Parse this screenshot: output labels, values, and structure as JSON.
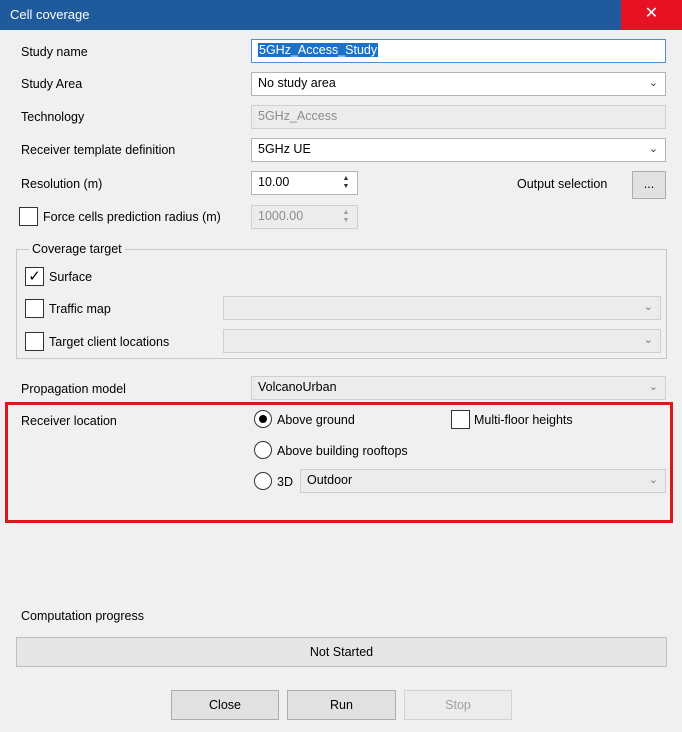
{
  "window": {
    "title": "Cell coverage",
    "close_glyph": "✕"
  },
  "fields": {
    "study_name": {
      "label": "Study name",
      "value": "5GHz_Access_Study"
    },
    "study_area": {
      "label": "Study Area",
      "value": "No study area"
    },
    "technology": {
      "label": "Technology",
      "value": "5GHz_Access"
    },
    "receiver_template": {
      "label": "Receiver template definition",
      "value": "5GHz UE"
    },
    "resolution": {
      "label": "Resolution (m)",
      "value": "10.00"
    },
    "output_selection": {
      "label": "Output selection",
      "button_label": "..."
    },
    "force_radius": {
      "label": "Force cells prediction radius (m)",
      "value": "1000.00",
      "checked": false
    }
  },
  "coverage_target": {
    "title": "Coverage target",
    "surface": {
      "label": "Surface",
      "checked": true,
      "check_glyph": "✓"
    },
    "traffic_map": {
      "label": "Traffic map",
      "checked": false,
      "value": ""
    },
    "target_client_locations": {
      "label": "Target client locations",
      "checked": false,
      "value": ""
    }
  },
  "propagation_model": {
    "label": "Propagation model",
    "value": "VolcanoUrban"
  },
  "receiver_location": {
    "label": "Receiver location",
    "above_ground": {
      "label": "Above ground",
      "selected": true
    },
    "multi_floor": {
      "label": "Multi-floor heights",
      "checked": false
    },
    "above_rooftops": {
      "label": "Above building rooftops",
      "selected": false
    },
    "three_d": {
      "label": "3D",
      "selected": false,
      "value": "Outdoor"
    }
  },
  "progress": {
    "label": "Computation progress",
    "status": "Not Started"
  },
  "buttons": {
    "close": "Close",
    "run": "Run",
    "stop": "Stop"
  },
  "glyphs": {
    "dropdown": "⌄",
    "spin_up": "▲",
    "spin_down": "▼"
  },
  "colors": {
    "titlebar": "#1e5a9c",
    "close_button": "#e81123",
    "highlight_border": "#d7191c",
    "selection": "#1a73c8"
  }
}
